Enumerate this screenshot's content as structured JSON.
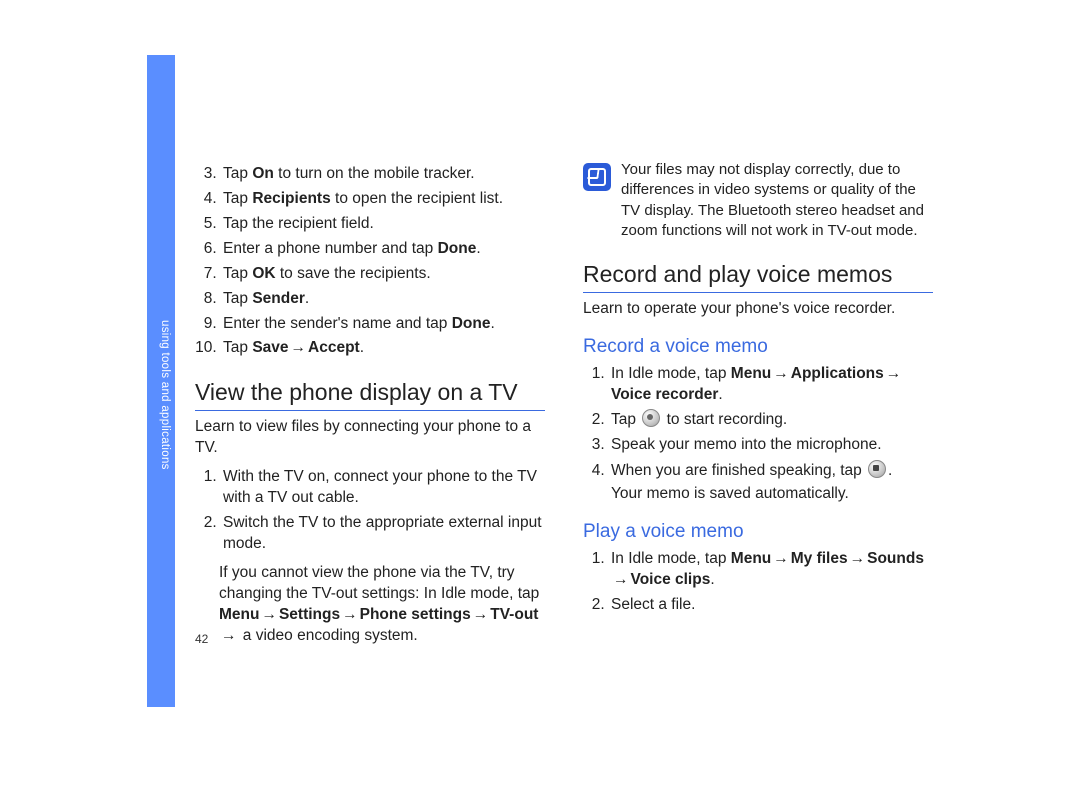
{
  "section_tab": "using tools and applications",
  "page_number": "42",
  "arrow": "→",
  "left_column": {
    "step3": {
      "pre": "Tap ",
      "bold": "On",
      "post": " to turn on the mobile tracker."
    },
    "step4": {
      "pre": "Tap ",
      "bold": "Recipients",
      "post": " to open the recipient list."
    },
    "step5": "Tap the recipient field.",
    "step6": {
      "pre": "Enter a phone number and tap ",
      "bold": "Done",
      "post": "."
    },
    "step7": {
      "pre": "Tap ",
      "bold": "OK",
      "post": " to save the recipients."
    },
    "step8": {
      "pre": "Tap ",
      "bold": "Sender",
      "post": "."
    },
    "step9": {
      "pre": "Enter the sender's name and tap ",
      "bold": "Done",
      "post": "."
    },
    "step10": {
      "pre": "Tap ",
      "b1": "Save",
      "mid": " → ",
      "b2": "Accept",
      "post": "."
    },
    "heading_tv": "View the phone display on a TV",
    "intro_tv": "Learn to view files by connecting your phone to a TV.",
    "tv_step1": "With the TV on, connect your phone to the TV with a TV out cable.",
    "tv_step2": "Switch the TV to the appropriate external input mode.",
    "tv_note_pre": "If you cannot view the phone via the TV, try changing the TV-out settings: In Idle mode, tap ",
    "tv_note_b1": "Menu",
    "tv_note_b2": "Settings",
    "tv_note_b3": "Phone settings",
    "tv_note_b4": "TV-out",
    "tv_note_post": " a video encoding system."
  },
  "right_column": {
    "note_text": "Your files may not display correctly, due to differences in video systems or quality of the TV display. The Bluetooth stereo headset and zoom functions will not work in TV-out mode.",
    "heading_voice": "Record and play voice memos",
    "intro_voice": "Learn to operate your phone's voice recorder.",
    "sub_record": "Record a voice memo",
    "rec_step1_pre": "In Idle mode, tap ",
    "rec_step1_b1": "Menu",
    "rec_step1_b2": "Applications",
    "rec_step1_b3": "Voice recorder",
    "rec_step1_post": ".",
    "rec_step2_pre": "Tap ",
    "rec_step2_post": " to start recording.",
    "rec_step3": "Speak your memo into the microphone.",
    "rec_step4_pre": "When you are finished speaking, tap ",
    "rec_step4_post": ".",
    "rec_step4_sub": "Your memo is saved automatically.",
    "sub_play": "Play a voice memo",
    "play_step1_pre": "In Idle mode, tap ",
    "play_step1_b1": "Menu",
    "play_step1_b2": "My files",
    "play_step1_b3": "Sounds",
    "play_step1_b4": "Voice clips",
    "play_step1_post": ".",
    "play_step2": "Select a file."
  }
}
